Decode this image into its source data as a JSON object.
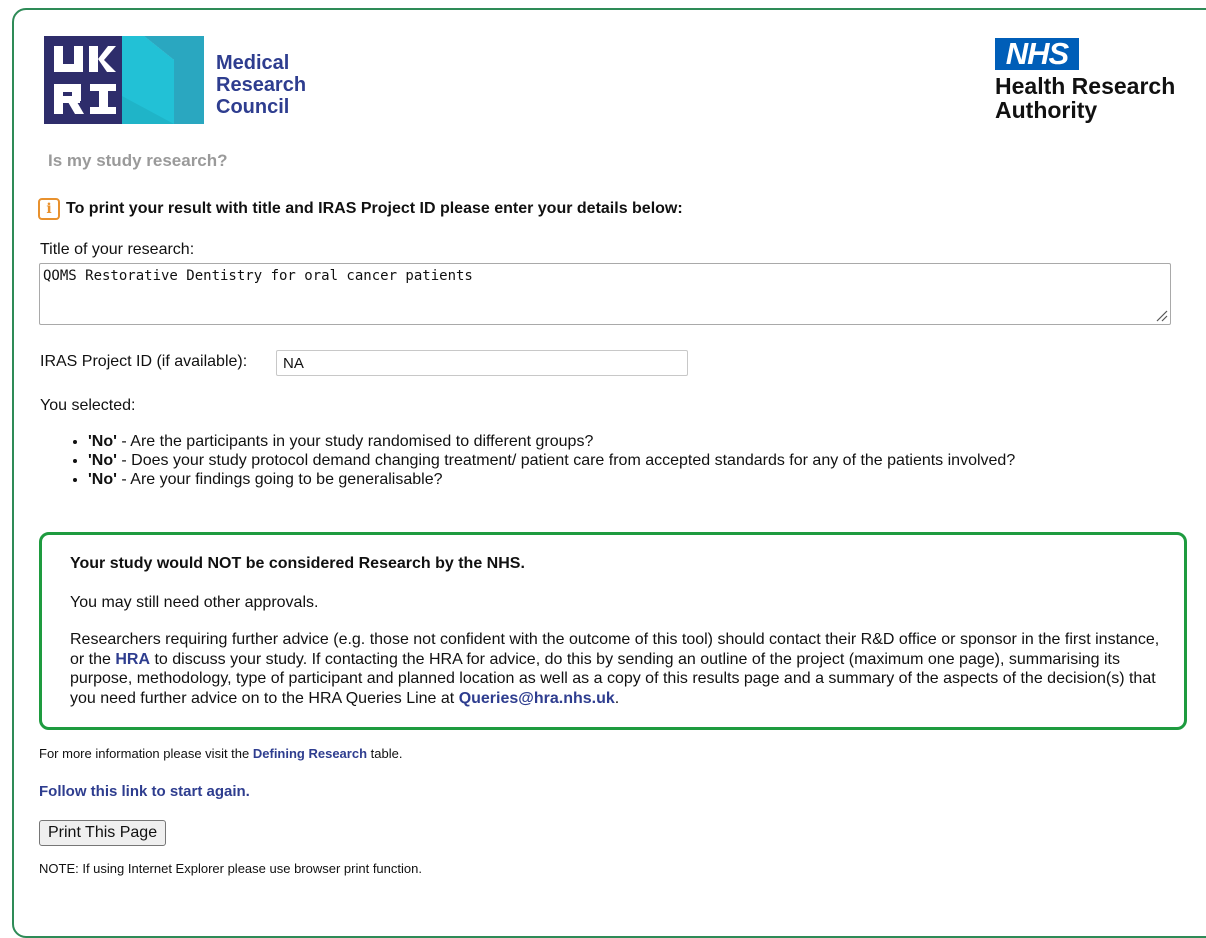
{
  "header": {
    "mrc_lines": [
      "Medical",
      "Research",
      "Council"
    ],
    "ukri_logo_text": "UKRI",
    "nhs_badge": "NHS",
    "hra_lines": [
      "Health Research",
      "Authority"
    ]
  },
  "page_subtitle": "Is my study research?",
  "info_instruction": "To print your result with title and IRAS Project ID please enter your details below:",
  "form": {
    "title_label": "Title of your research:",
    "title_value": "QOMS Restorative Dentistry for oral cancer patients",
    "iras_label": "IRAS Project ID (if available):",
    "iras_value": "NA"
  },
  "selected_label": "You selected:",
  "selections": [
    {
      "answer": "'No'",
      "question": " - Are the participants in your study randomised to different groups?"
    },
    {
      "answer": "'No'",
      "question": " - Does your study protocol demand changing treatment/ patient care from accepted standards for any of the patients involved?"
    },
    {
      "answer": "'No'",
      "question": " - Are your findings going to be generalisable?"
    }
  ],
  "result": {
    "heading": "Your study would NOT be considered Research by the NHS.",
    "approvals": "You may still need other approvals.",
    "advice_part1": "Researchers requiring further advice (e.g. those not confident with the outcome of this tool) should contact their R&D office or sponsor in the first instance, or the ",
    "hra_link": "HRA",
    "advice_part2": " to discuss your study. If contacting the HRA for advice, do this by sending an outline of the project (maximum one page), summarising its purpose, methodology, type of participant and planned location as well as a copy of this results page and a summary of the aspects of the decision(s) that you need further advice on to the HRA Queries Line at ",
    "email_link": "Queries@hra.nhs.uk",
    "advice_end": "."
  },
  "footer": {
    "more_info_prefix": "For more information please visit the ",
    "defining_research_link": "Defining Research",
    "more_info_suffix": " table.",
    "start_again_link": "Follow this link to start again.",
    "print_button": "Print This Page",
    "note": "NOTE: If using Internet Explorer please use browser print function."
  },
  "colors": {
    "frame_border": "#2e8b57",
    "result_border": "#1e9b3f",
    "link": "#2e3d8f",
    "nhs_blue": "#005eb8",
    "info_orange": "#e8912e"
  }
}
